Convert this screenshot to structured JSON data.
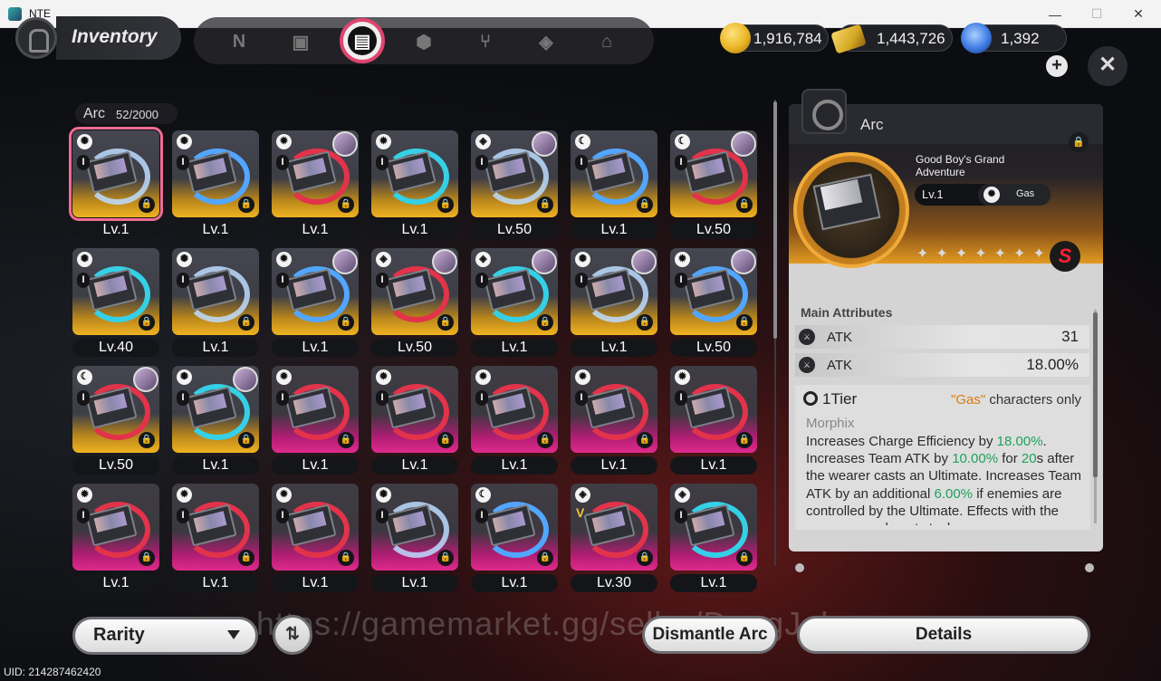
{
  "window": {
    "title": "NTE",
    "minimize": "—",
    "maximize": "☐",
    "close": "✕"
  },
  "header": {
    "title": "Inventory",
    "tabs": [
      "N",
      "▣",
      "▤",
      "⬢",
      "⑂",
      "◈",
      "⌂"
    ],
    "active_tab": 2
  },
  "currencies": [
    {
      "name": "gold-coin",
      "value": "1,916,784",
      "color": "#e9b526"
    },
    {
      "name": "ticket",
      "value": "1,443,726",
      "color": "#d6a923"
    },
    {
      "name": "crystal",
      "value": "1,392",
      "color": "#3e7be3"
    }
  ],
  "plus_label": "+",
  "close_label": "✕",
  "list": {
    "label": "Arc",
    "count": "52/2000"
  },
  "icons": {
    "lock": "🔒",
    "elem_swirl": "✺",
    "elem_gear": "✹",
    "elem_cube": "◈",
    "elem_moon": "☾"
  },
  "cards": [
    {
      "lv": "Lv.1",
      "rarity": "gold",
      "elem": "swirl",
      "tier": "I",
      "avatar": false,
      "selected": true
    },
    {
      "lv": "Lv.1",
      "rarity": "gold",
      "elem": "swirl",
      "tier": "I",
      "avatar": false
    },
    {
      "lv": "Lv.1",
      "rarity": "gold",
      "elem": "gear",
      "tier": "I",
      "avatar": true
    },
    {
      "lv": "Lv.1",
      "rarity": "gold",
      "elem": "gear",
      "tier": "I",
      "avatar": false
    },
    {
      "lv": "Lv.50",
      "rarity": "gold",
      "elem": "cube",
      "tier": "I",
      "avatar": true
    },
    {
      "lv": "Lv.1",
      "rarity": "gold",
      "elem": "moon",
      "tier": "I",
      "avatar": false
    },
    {
      "lv": "Lv.50",
      "rarity": "gold",
      "elem": "moon",
      "tier": "I",
      "avatar": true
    },
    {
      "lv": "Lv.40",
      "rarity": "gold",
      "elem": "swirl",
      "tier": "I",
      "avatar": false
    },
    {
      "lv": "Lv.1",
      "rarity": "gold",
      "elem": "swirl",
      "tier": "I",
      "avatar": false
    },
    {
      "lv": "Lv.1",
      "rarity": "gold",
      "elem": "gear",
      "tier": "I",
      "avatar": true
    },
    {
      "lv": "Lv.50",
      "rarity": "gold",
      "elem": "cube",
      "tier": "I",
      "avatar": true
    },
    {
      "lv": "Lv.1",
      "rarity": "gold",
      "elem": "cube",
      "tier": "I",
      "avatar": true
    },
    {
      "lv": "Lv.1",
      "rarity": "gold",
      "elem": "swirl",
      "tier": "I",
      "avatar": true
    },
    {
      "lv": "Lv.50",
      "rarity": "gold",
      "elem": "gear",
      "tier": "I",
      "avatar": true
    },
    {
      "lv": "Lv.50",
      "rarity": "gold",
      "elem": "moon",
      "tier": "I",
      "avatar": true
    },
    {
      "lv": "Lv.1",
      "rarity": "gold",
      "elem": "swirl",
      "tier": "I",
      "avatar": true
    },
    {
      "lv": "Lv.1",
      "rarity": "pink",
      "elem": "gear",
      "tier": "I",
      "avatar": false
    },
    {
      "lv": "Lv.1",
      "rarity": "pink",
      "elem": "gear",
      "tier": "I",
      "avatar": false
    },
    {
      "lv": "Lv.1",
      "rarity": "pink",
      "elem": "gear",
      "tier": "I",
      "avatar": false
    },
    {
      "lv": "Lv.1",
      "rarity": "pink",
      "elem": "gear",
      "tier": "I",
      "avatar": false
    },
    {
      "lv": "Lv.1",
      "rarity": "pink",
      "elem": "gear",
      "tier": "I",
      "avatar": false
    },
    {
      "lv": "Lv.1",
      "rarity": "pink",
      "elem": "gear",
      "tier": "I",
      "avatar": false
    },
    {
      "lv": "Lv.1",
      "rarity": "pink",
      "elem": "gear",
      "tier": "I",
      "avatar": false
    },
    {
      "lv": "Lv.1",
      "rarity": "pink",
      "elem": "gear",
      "tier": "I",
      "avatar": false
    },
    {
      "lv": "Lv.1",
      "rarity": "pink",
      "elem": "swirl",
      "tier": "I",
      "avatar": false
    },
    {
      "lv": "Lv.1",
      "rarity": "pink",
      "elem": "moon",
      "tier": "I",
      "avatar": false
    },
    {
      "lv": "Lv.30",
      "rarity": "pink",
      "elem": "cube",
      "tier": "V",
      "avatar": false
    },
    {
      "lv": "Lv.1",
      "rarity": "pink",
      "elem": "cube",
      "tier": "I",
      "avatar": false
    }
  ],
  "detail": {
    "category": "Arc",
    "name": "Good Boy's Grand Adventure",
    "level": "Lv.1",
    "element": "Gas",
    "stars": "✦✦✦✦✦✦✦",
    "rank": "S",
    "main_attributes_title": "Main Attributes",
    "attributes": [
      {
        "name": "ATK",
        "value": "31"
      },
      {
        "name": "ATK",
        "value": "18.00%"
      }
    ],
    "tier_label": "1Tier",
    "tier_gas": "\"Gas\"",
    "tier_only": " characters only",
    "morphix_title": "Morphix",
    "desc_parts": [
      {
        "t": "Increases Charge Efficiency by ",
        "g": false
      },
      {
        "t": "18.00%",
        "g": true
      },
      {
        "t": ". Increases Team ATK by ",
        "g": false
      },
      {
        "t": "10.00%",
        "g": true
      },
      {
        "t": " for ",
        "g": false
      },
      {
        "t": "20",
        "g": true
      },
      {
        "t": "s after the wearer casts an Ultimate. Increases Team ATK by an additional ",
        "g": false
      },
      {
        "t": "6.00%",
        "g": true
      },
      {
        "t": " if enemies are controlled by the Ultimate. Effects with the same name do not stack.",
        "g": false
      }
    ]
  },
  "bottom": {
    "rarity_label": "Rarity",
    "sort_icon": "⇅",
    "dismantle_label": "Dismantle Arc",
    "details_label": "Details",
    "watermark": "https://gamemarket.gg/seller/DangJohn"
  },
  "uid": "UID: 214287462420"
}
